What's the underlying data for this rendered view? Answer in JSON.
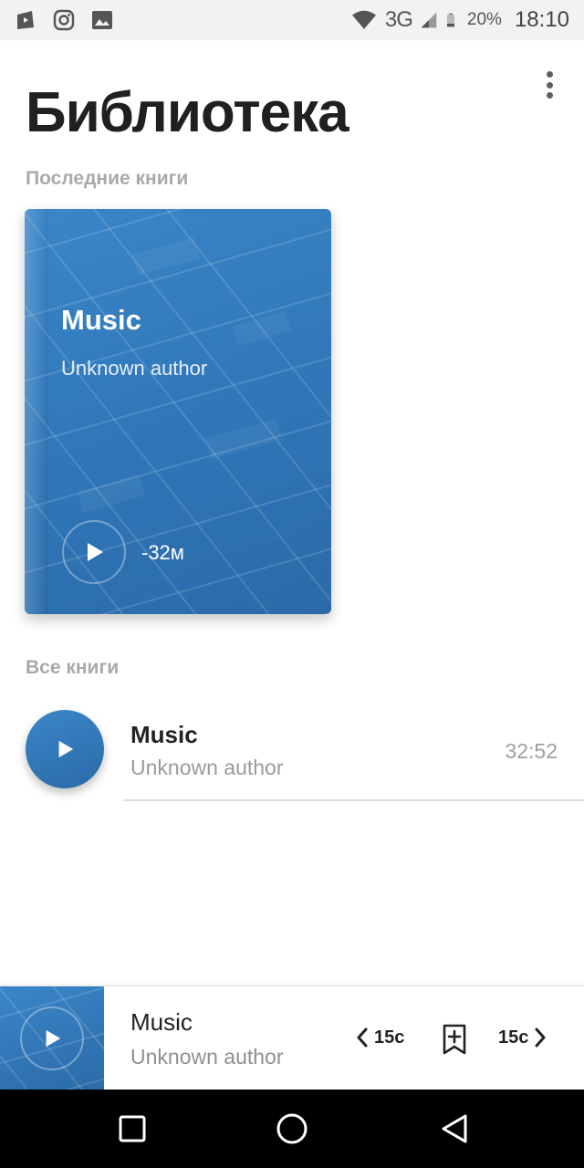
{
  "status_bar": {
    "network": "3G",
    "battery": "20%",
    "time": "18:10",
    "icons": [
      "app-notification-icon",
      "instagram-icon",
      "gallery-icon",
      "wifi-icon",
      "signal-icon",
      "battery-icon"
    ]
  },
  "header": {
    "title": "Библиотека",
    "menu_icon": "more-vert-icon"
  },
  "recent": {
    "label": "Последние книги",
    "book": {
      "title": "Music",
      "author": "Unknown author",
      "remaining": "-32м"
    }
  },
  "all_books": {
    "label": "Все книги",
    "items": [
      {
        "title": "Music",
        "author": "Unknown author",
        "duration": "32:52"
      }
    ]
  },
  "mini_player": {
    "title": "Music",
    "author": "Unknown author",
    "skip_back_label": "15с",
    "skip_forward_label": "15с"
  },
  "colors": {
    "accent": "#2f76b8",
    "accent_light": "#3a86c8",
    "title_text": "#202020",
    "muted_text": "#a9a9a9"
  }
}
